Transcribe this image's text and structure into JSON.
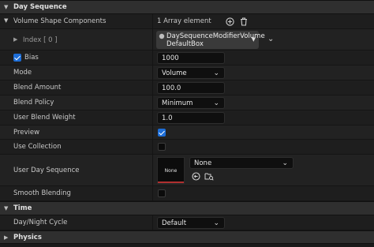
{
  "sections": {
    "day_sequence": "Day Sequence",
    "time": "Time",
    "physics": "Physics"
  },
  "volume_shape": {
    "label": "Volume Shape Components",
    "count": "1 Array element",
    "index_label": "Index [ 0 ]",
    "asset_line1": "DaySequenceModifierVolume",
    "asset_line2": "DefaultBox"
  },
  "bias": {
    "label": "Bias",
    "value": "1000",
    "checked": true
  },
  "mode": {
    "label": "Mode",
    "value": "Volume"
  },
  "blend_amount": {
    "label": "Blend Amount",
    "value": "100.0"
  },
  "blend_policy": {
    "label": "Blend Policy",
    "value": "Minimum"
  },
  "user_blend_weight": {
    "label": "User Blend Weight",
    "value": "1.0"
  },
  "preview": {
    "label": "Preview",
    "checked": true
  },
  "use_collection": {
    "label": "Use Collection",
    "checked": false
  },
  "user_day_sequence": {
    "label": "User Day Sequence",
    "thumb": "None",
    "value": "None"
  },
  "smooth_blending": {
    "label": "Smooth Blending",
    "checked": false
  },
  "day_night_cycle": {
    "label": "Day/Night Cycle",
    "value": "Default"
  },
  "colors": {
    "accent": "#1d6ed8",
    "background": "#1a1a1a",
    "header": "#2f2f2f"
  }
}
